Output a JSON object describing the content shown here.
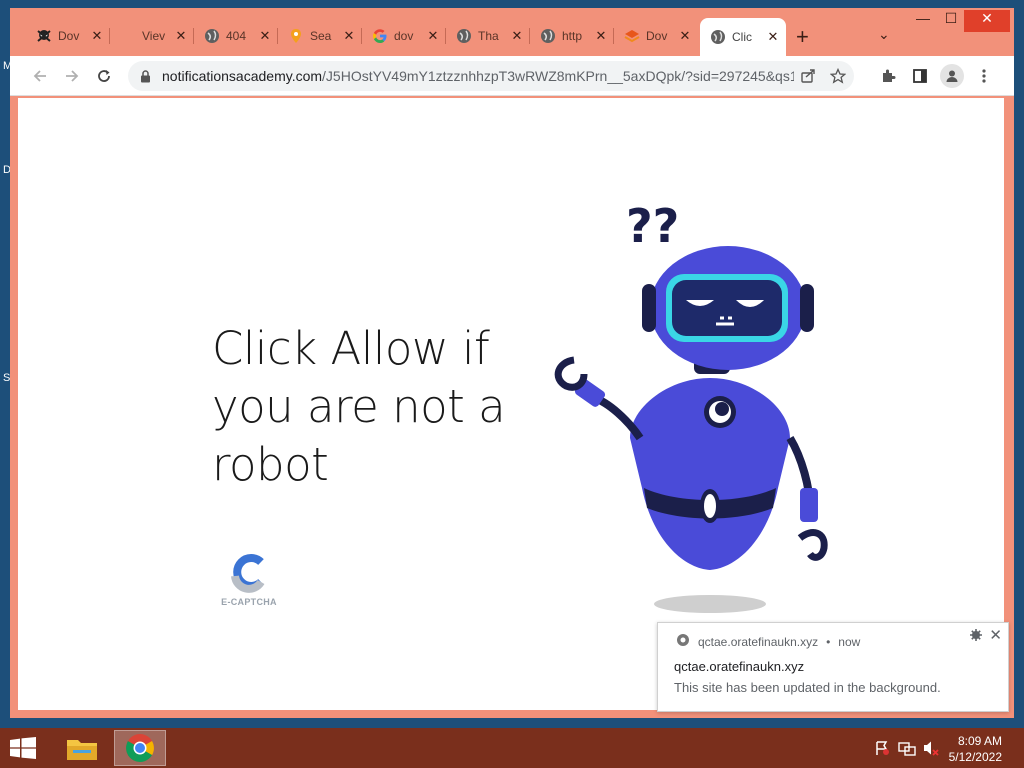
{
  "desktop": {
    "edge_labels": [
      "M",
      "D",
      "S"
    ]
  },
  "browser": {
    "tabs": [
      {
        "title": "Dov",
        "icon": "skull-icon"
      },
      {
        "title": "Viev",
        "icon": "none"
      },
      {
        "title": "404",
        "icon": "globe-icon"
      },
      {
        "title": "Sea",
        "icon": "map-pin-icon"
      },
      {
        "title": "dov",
        "icon": "google-icon"
      },
      {
        "title": "Tha",
        "icon": "globe-icon"
      },
      {
        "title": "http",
        "icon": "globe-icon"
      },
      {
        "title": "Dov",
        "icon": "stack-icon"
      },
      {
        "title": "Clic",
        "icon": "globe-icon",
        "active": true
      }
    ],
    "new_tab": "+",
    "tab_search": "⌄",
    "window_controls": {
      "minimize": "—",
      "maximize": "☐",
      "close": "✕"
    },
    "address": {
      "host": "notificationsacademy.com",
      "path": "/J5HOstYV49mY1ztzznhhzpT3wRWZ8mKPrn__5axDQpk/?sid=297245&qs1..."
    }
  },
  "page": {
    "headline": "Click Allow if you are not a robot",
    "captcha_label": "E-CAPTCHA",
    "robot_thought": "??"
  },
  "notification": {
    "origin": "qctae.oratefinaukn.xyz",
    "time": "now",
    "title": "qctae.oratefinaukn.xyz",
    "message": "This site has been updated in the background."
  },
  "taskbar": {
    "time": "8:09 AM",
    "date": "5/12/2022"
  },
  "colors": {
    "frame": "#f2917a",
    "taskbar": "#7a2f1c",
    "robot_body": "#4a4bd8",
    "visor": "#1e2a6a",
    "visor_glow": "#3ad6e6"
  }
}
